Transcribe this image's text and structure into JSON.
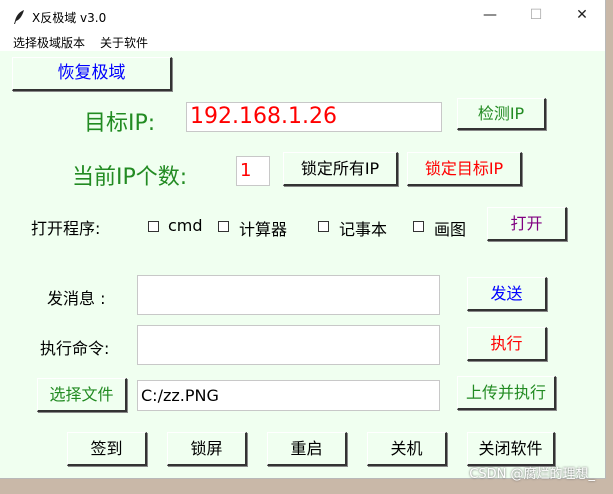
{
  "window": {
    "title": "X反极域 v3.0",
    "minimize_glyph": "—",
    "maximize_glyph": "☐",
    "close_glyph": "✕"
  },
  "menu": [
    "选择极域版本",
    "关于软件"
  ],
  "restore_button": "恢复极域",
  "target_ip": {
    "label": "目标IP:",
    "value": "192.168.1.26",
    "detect_button": "检测IP"
  },
  "ip_count": {
    "label": "当前IP个数:",
    "value": "1",
    "lock_all_button": "锁定所有IP",
    "lock_target_button": "锁定目标IP"
  },
  "programs": {
    "label": "打开程序:",
    "items": [
      "cmd",
      "计算器",
      "记事本",
      "画图"
    ],
    "open_button": "打开"
  },
  "message": {
    "label": "发消息 :",
    "value": "",
    "send_button": "发送"
  },
  "command": {
    "label": "执行命令:",
    "value": "",
    "exec_button": "执行"
  },
  "file": {
    "choose_button": "选择文件",
    "path": "C:/zz.PNG",
    "upload_button": "上传并执行"
  },
  "bottom_buttons": [
    "签到",
    "锁屏",
    "重启",
    "关机",
    "关闭软件"
  ],
  "watermark": "CSDN @腐烂的理想_",
  "colors": {
    "client_bg": "#f0fff0",
    "green": "#228b22",
    "red": "#ff0000",
    "blue": "#0000ff",
    "purple": "#800080"
  }
}
